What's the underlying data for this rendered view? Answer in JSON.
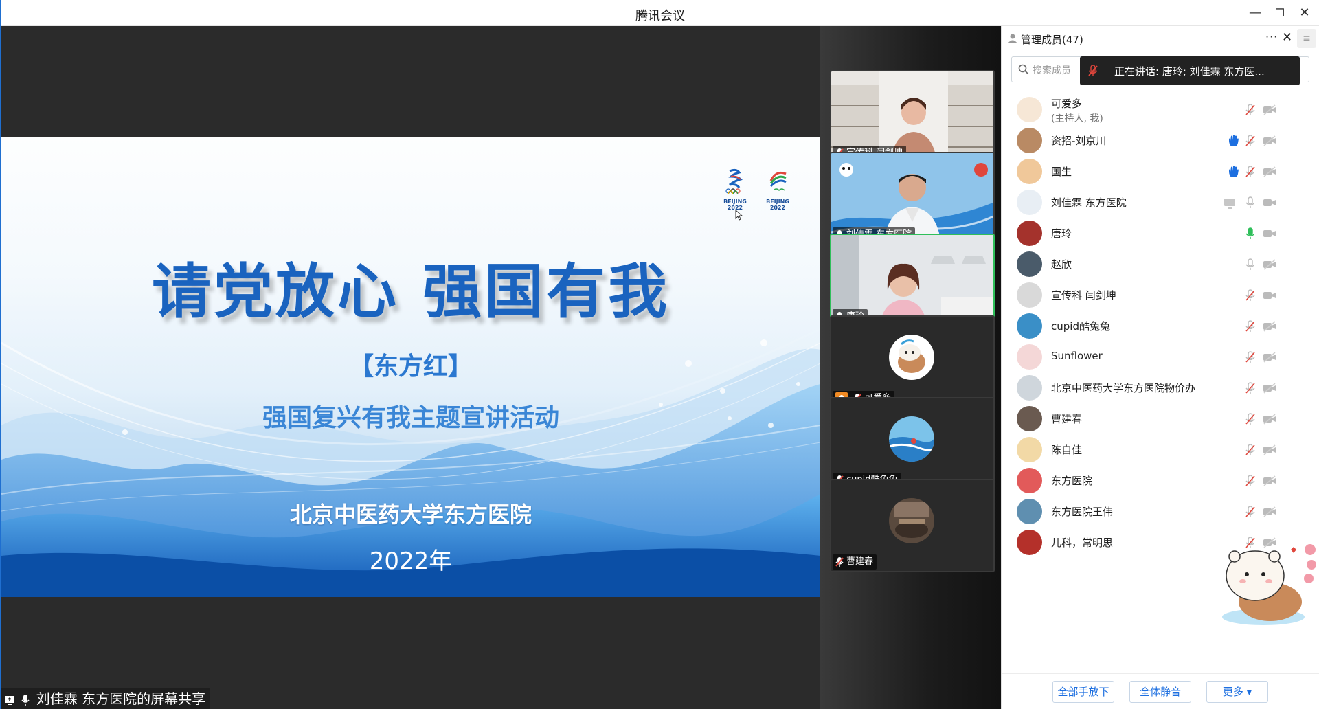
{
  "window": {
    "title": "腾讯会议",
    "minimize": "—",
    "restore": "❐",
    "close": "✕"
  },
  "slide": {
    "headline": "请党放心  强国有我",
    "org": "【东方红】",
    "subtitle": "强国复兴有我主题宣讲活动",
    "hospital": "北京中医药大学东方医院",
    "year": "2022年",
    "logo_caption_1": "BEIJING 2022",
    "logo_caption_2": "BEIJING 2022"
  },
  "share_label": "刘佳霖 东方医院的屏幕共享",
  "video_tiles": [
    {
      "name": "宣传科 闫剑坤",
      "muted": true
    },
    {
      "name": "刘佳霖 东方医院",
      "muted": false
    },
    {
      "name": "唐玲",
      "muted": false,
      "speaking": true
    },
    {
      "name": "可爱多",
      "muted": true
    },
    {
      "name": "cupid酷兔兔",
      "muted": true
    },
    {
      "name": "曹建春",
      "muted": true
    }
  ],
  "panel": {
    "title": "管理成员(47)",
    "more": "···",
    "close": "✕",
    "menu": "≡",
    "search_placeholder": "搜索成员",
    "speaking_toast": "正在讲话: 唐玲; 刘佳霖 东方医..."
  },
  "members": [
    {
      "name": "可爱多",
      "sub": "(主持人, 我)",
      "hand": false,
      "mic": "muted",
      "cam": "off"
    },
    {
      "name": "资招-刘京川",
      "hand": true,
      "mic": "muted",
      "cam": "off"
    },
    {
      "name": "国生",
      "hand": true,
      "mic": "muted",
      "cam": "off"
    },
    {
      "name": "刘佳霖 东方医院",
      "hand": false,
      "sharing": true,
      "mic": "on",
      "cam": "on"
    },
    {
      "name": "唐玲",
      "hand": false,
      "mic": "speaking",
      "cam": "on"
    },
    {
      "name": "赵欣",
      "hand": false,
      "mic": "on",
      "cam": "off"
    },
    {
      "name": "宣传科 闫剑坤",
      "hand": false,
      "mic": "muted",
      "cam": "on"
    },
    {
      "name": "cupid酷兔兔",
      "hand": false,
      "mic": "muted",
      "cam": "off"
    },
    {
      "name": "Sunflower",
      "hand": false,
      "mic": "muted",
      "cam": "off"
    },
    {
      "name": "北京中医药大学东方医院物价办",
      "hand": false,
      "mic": "muted",
      "cam": "off"
    },
    {
      "name": "曹建春",
      "hand": false,
      "mic": "muted",
      "cam": "off"
    },
    {
      "name": "陈自佳",
      "hand": false,
      "mic": "muted",
      "cam": "off"
    },
    {
      "name": "东方医院",
      "hand": false,
      "mic": "muted",
      "cam": "off"
    },
    {
      "name": "东方医院王伟",
      "hand": false,
      "mic": "muted",
      "cam": "off"
    },
    {
      "name": "儿科，常明思",
      "hand": false,
      "mic": "muted",
      "cam": "off"
    }
  ],
  "footer": {
    "lower_all_hands": "全部手放下",
    "mute_all": "全体静音",
    "more": "更多 ▾"
  },
  "colors": {
    "accent": "#1d6fe0",
    "speaking_green": "#2fbf5a",
    "hand_blue": "#1d6fe0",
    "muted_red": "#e0463c",
    "slide_blue": "#1a63bf"
  }
}
